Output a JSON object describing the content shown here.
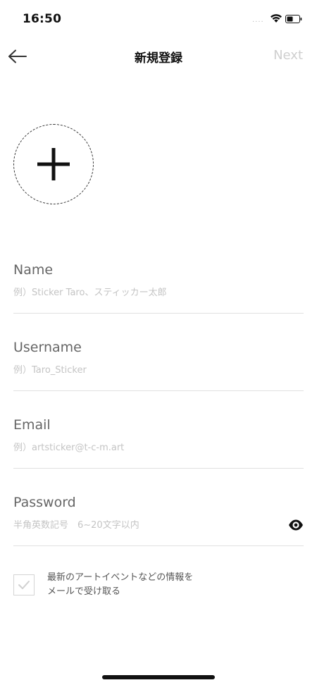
{
  "status_bar": {
    "time": "16:50",
    "signal": "....",
    "icons": [
      "wifi-icon",
      "battery-icon"
    ]
  },
  "nav": {
    "back_icon": "arrow-left-icon",
    "title": "新規登録",
    "next_label": "Next"
  },
  "avatar": {
    "icon": "plus-icon"
  },
  "form": {
    "name": {
      "label": "Name",
      "placeholder": "例）Sticker Taro、スティッカー太郎"
    },
    "username": {
      "label": "Username",
      "placeholder": "例）Taro_Sticker"
    },
    "email": {
      "label": "Email",
      "placeholder": "例）artsticker@t-c-m.art"
    },
    "password": {
      "label": "Password",
      "placeholder": "半角英数記号　6~20文字以内",
      "toggle_icon": "eye-icon"
    }
  },
  "newsletter": {
    "line1": "最新のアートイベントなどの情報を",
    "line2": "メールで受け取る",
    "checked": false
  },
  "colors": {
    "text_primary": "#111111",
    "label_gray": "#666666",
    "placeholder_gray": "#c4c4c4",
    "next_disabled": "#cfcfcf",
    "divider": "#e0e0e0"
  }
}
